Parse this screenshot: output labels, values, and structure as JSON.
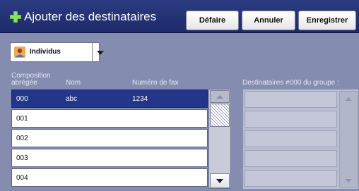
{
  "header": {
    "title": "Ajouter des destinataires",
    "undo_label": "Défaire",
    "cancel_label": "Annuler",
    "save_label": "Enregistrer"
  },
  "filter": {
    "selected": "Individus"
  },
  "columns": {
    "abbrev": "Composition abrégée",
    "name": "Nom",
    "fax": "Numéro de fax"
  },
  "rows": [
    {
      "code": "000",
      "name": "abc",
      "fax": "1234"
    },
    {
      "code": "001",
      "name": "",
      "fax": ""
    },
    {
      "code": "002",
      "name": "",
      "fax": ""
    },
    {
      "code": "003",
      "name": "",
      "fax": ""
    },
    {
      "code": "004",
      "name": "",
      "fax": ""
    }
  ],
  "group": {
    "heading": "Destinataires #000 du groupe :"
  },
  "colors": {
    "header_bg": "#1d2a6a",
    "page_bg": "#848cb0",
    "selected_row": "#24368a"
  }
}
